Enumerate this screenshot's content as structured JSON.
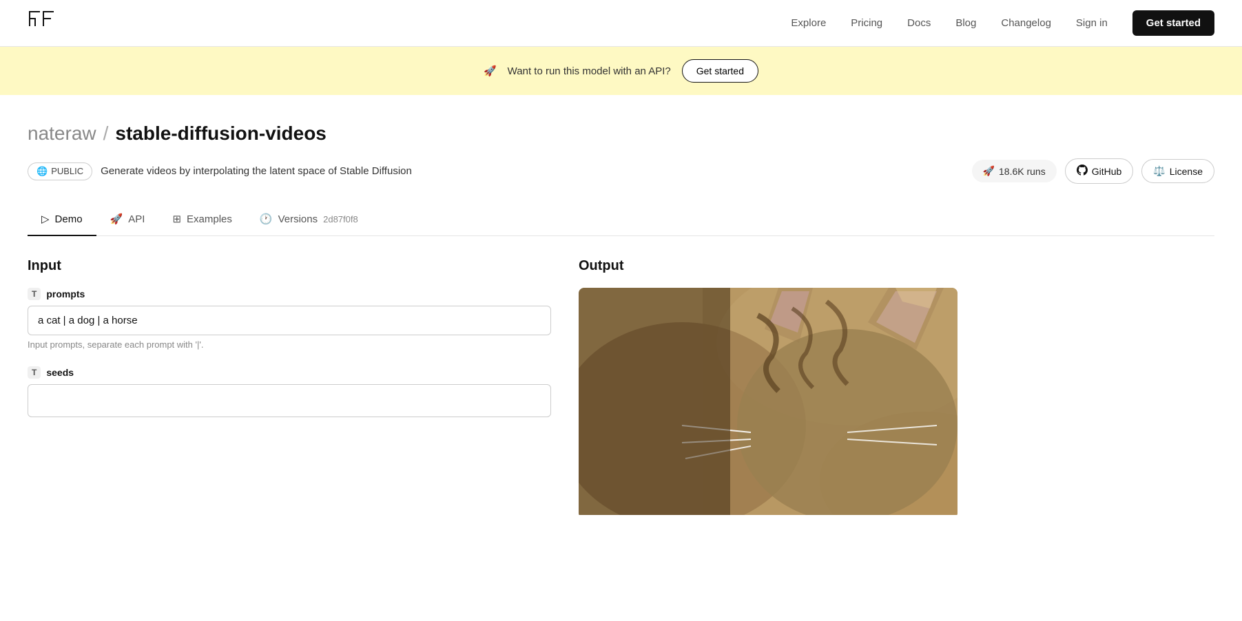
{
  "nav": {
    "logo_alt": "Replicate logo",
    "links": [
      {
        "label": "Explore",
        "href": "#"
      },
      {
        "label": "Pricing",
        "href": "#"
      },
      {
        "label": "Docs",
        "href": "#"
      },
      {
        "label": "Blog",
        "href": "#"
      },
      {
        "label": "Changelog",
        "href": "#"
      },
      {
        "label": "Sign in",
        "href": "#"
      }
    ],
    "cta_label": "Get started"
  },
  "banner": {
    "emoji": "🚀",
    "text": "Want to run this model with an API?",
    "cta_label": "Get started"
  },
  "breadcrumb": {
    "user": "nateraw",
    "separator": "/",
    "repo": "stable-diffusion-videos"
  },
  "model": {
    "visibility": "PUBLIC",
    "description": "Generate videos by interpolating the latent space of Stable Diffusion",
    "runs_label": "18.6K runs",
    "github_label": "GitHub",
    "license_label": "License"
  },
  "tabs": [
    {
      "label": "Demo",
      "icon": "play-icon",
      "active": true
    },
    {
      "label": "API",
      "icon": "rocket-icon",
      "active": false
    },
    {
      "label": "Examples",
      "icon": "grid-icon",
      "active": false
    },
    {
      "label": "Versions",
      "icon": "clock-icon",
      "active": false,
      "hash": "2d87f0f8"
    }
  ],
  "input": {
    "section_title": "Input",
    "fields": [
      {
        "type": "T",
        "name": "prompts",
        "value": "a cat | a dog | a horse",
        "hint": "Input prompts, separate each prompt with '|'."
      },
      {
        "type": "T",
        "name": "seeds",
        "value": "",
        "hint": ""
      }
    ]
  },
  "output": {
    "section_title": "Output",
    "image_alt": "Output image showing a cat"
  }
}
